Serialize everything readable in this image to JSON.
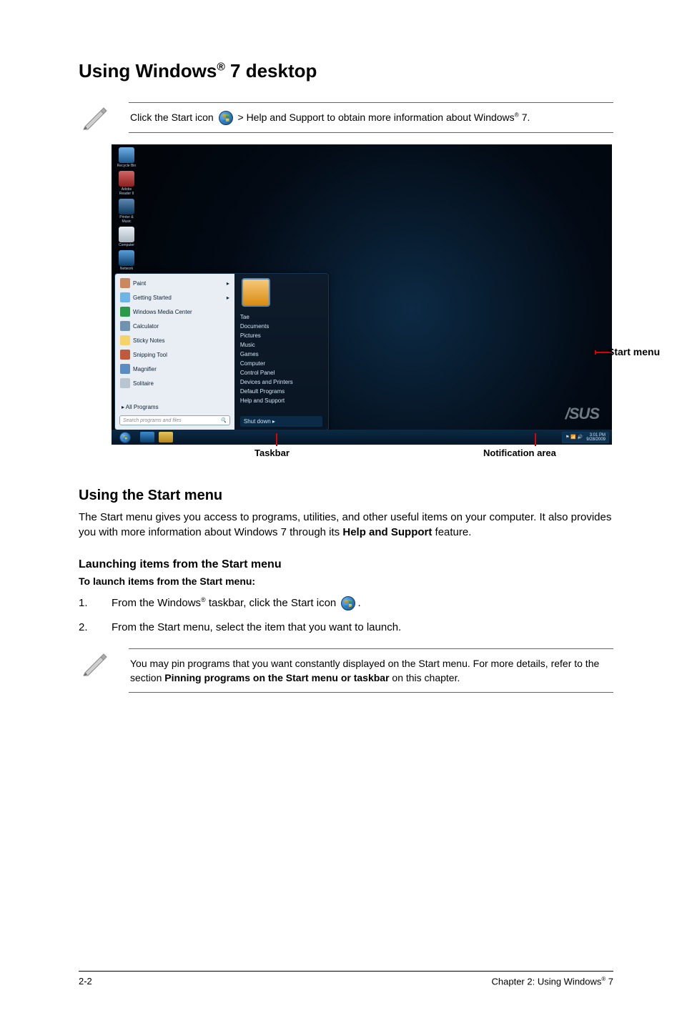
{
  "title_prefix": "Using Windows",
  "title_suffix": " 7 desktop",
  "note1": {
    "pre": "Click the Start icon ",
    "post": " > Help and Support to obtain more information about Windows",
    "tail": " 7."
  },
  "screenshot": {
    "desktop_icons": [
      {
        "label": "Recycle Bin",
        "color": "#2f70b5",
        "glyph": ""
      },
      {
        "label": "Adobe Reader 9",
        "color": "#b02727",
        "glyph": ""
      },
      {
        "label": "Printer & Music",
        "color": "#1f578c",
        "glyph": ""
      },
      {
        "label": "Computer",
        "color": "#cfd6dd",
        "glyph": ""
      },
      {
        "label": "Network",
        "color": "#1f6fb0",
        "glyph": ""
      }
    ],
    "start_left": [
      {
        "label": "Paint",
        "color": "#c9885e"
      },
      {
        "label": "Getting Started",
        "color": "#6fb4e6"
      },
      {
        "label": "Windows Media Center",
        "color": "#2a9b4a"
      },
      {
        "label": "Calculator",
        "color": "#6f93b0"
      },
      {
        "label": "Sticky Notes",
        "color": "#f5d36a"
      },
      {
        "label": "Snipping Tool",
        "color": "#c05a3c"
      },
      {
        "label": "Magnifier",
        "color": "#5d8cc0"
      },
      {
        "label": "Solitaire",
        "color": "#b8c4cf"
      }
    ],
    "all_programs": "All Programs",
    "search_ph": "Search programs and files",
    "start_right": [
      "Documents",
      "Pictures",
      "Music",
      "Games",
      "Computer",
      "Control Panel",
      "Devices and Printers",
      "Default Programs",
      "Help and Support"
    ],
    "avatar_top_label": "Tae",
    "shutdown": "Shut down  ▸",
    "brand": "/SUS",
    "tray_time": "3:01 PM",
    "tray_date": "9/28/2009",
    "callouts": {
      "start_menu": "Start menu",
      "taskbar": "Taskbar",
      "notification": "Notification area"
    }
  },
  "section1": {
    "heading": "Using the Start menu",
    "body_pre": "The Start menu gives you access to programs, utilities, and other useful items on your computer. It also provides you with more information about Windows 7 through its ",
    "body_bold": "Help and Support",
    "body_post": " feature."
  },
  "section2": {
    "sub": "Launching items from the Start menu",
    "lead": "To launch items from the Start menu:",
    "step1_pre": "From the Windows",
    "step1_post": " taskbar, click the Start icon ",
    "step1_tail": ".",
    "step2": "From the Start menu, select the item that you want to launch."
  },
  "note2": {
    "pre": "You may pin programs that you want constantly displayed on the Start menu. For more details, refer to the section ",
    "bold": "Pinning programs on the Start menu or taskbar",
    "post": " on this chapter."
  },
  "footer": {
    "page": "2-2",
    "chapter_pre": "Chapter 2: Using Windows",
    "chapter_post": " 7"
  }
}
